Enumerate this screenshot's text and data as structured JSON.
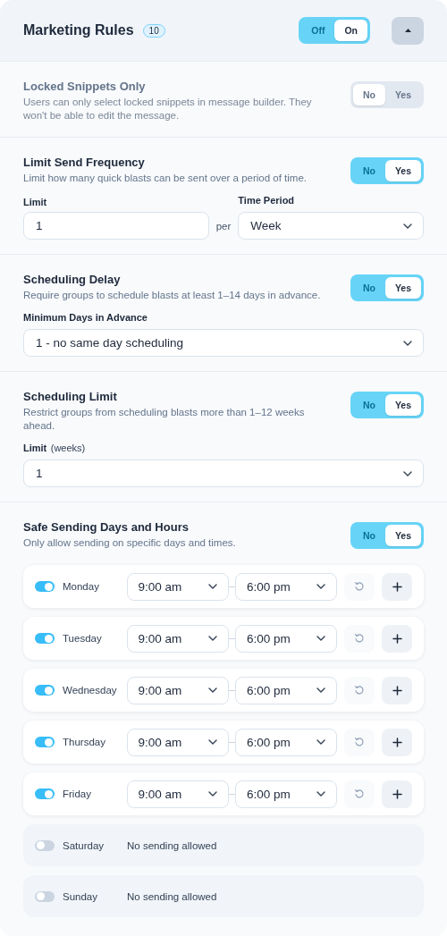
{
  "header": {
    "title": "Marketing Rules",
    "count": "10",
    "toggle": [
      {
        "label": "Off",
        "selected": false
      },
      {
        "label": "On",
        "selected": true
      }
    ],
    "expanded": true
  },
  "rules": [
    {
      "title": "Locked Snippets Only",
      "description": "Users can only select locked snippets in message builder. They won't be able to edit the message.",
      "disabled": true,
      "toggle": [
        {
          "label": "No",
          "selected": true
        },
        {
          "label": "Yes",
          "selected": false
        }
      ]
    },
    {
      "title": "Limit Send Frequency",
      "description": "Limit how many quick blasts can be sent over a period of time.",
      "disabled": false,
      "toggle": [
        {
          "label": "No",
          "selected": false
        },
        {
          "label": "Yes",
          "selected": true
        }
      ],
      "fields": [
        {
          "kind": "input",
          "label": "Limit",
          "value": "1"
        },
        {
          "kind": "joiner",
          "text": "per"
        },
        {
          "kind": "select",
          "label": "Time Period",
          "value": "Week"
        }
      ]
    },
    {
      "title": "Scheduling Delay",
      "description": "Require groups to schedule blasts at least 1–14 days in advance.",
      "disabled": false,
      "toggle": [
        {
          "label": "No",
          "selected": false
        },
        {
          "label": "Yes",
          "selected": true
        }
      ],
      "fields": [
        {
          "kind": "select",
          "label": "Minimum Days in Advance",
          "value": "1 - no same day scheduling"
        }
      ]
    },
    {
      "title": "Scheduling Limit",
      "description": "Restrict groups from scheduling blasts more than 1–12 weeks ahead.",
      "disabled": false,
      "toggle": [
        {
          "label": "No",
          "selected": false
        },
        {
          "label": "Yes",
          "selected": true
        }
      ],
      "fields": [
        {
          "kind": "select",
          "label": "Limit",
          "unit": "(weeks)",
          "value": "1"
        }
      ]
    },
    {
      "title": "Safe Sending Days and Hours",
      "description": "Only allow sending on specific days and times.",
      "disabled": false,
      "toggle": [
        {
          "label": "No",
          "selected": false
        },
        {
          "label": "Yes",
          "selected": true
        }
      ],
      "days": [
        {
          "name": "Monday",
          "on": true,
          "from": "9:00 am",
          "to": "6:00 pm"
        },
        {
          "name": "Tuesday",
          "on": true,
          "from": "9:00 am",
          "to": "6:00 pm"
        },
        {
          "name": "Wednesday",
          "on": true,
          "from": "9:00 am",
          "to": "6:00 pm"
        },
        {
          "name": "Thursday",
          "on": true,
          "from": "9:00 am",
          "to": "6:00 pm"
        },
        {
          "name": "Friday",
          "on": true,
          "from": "9:00 am",
          "to": "6:00 pm"
        },
        {
          "name": "Saturday",
          "on": false,
          "note": "No sending allowed"
        },
        {
          "name": "Sunday",
          "on": false,
          "note": "No sending allowed"
        }
      ]
    }
  ]
}
